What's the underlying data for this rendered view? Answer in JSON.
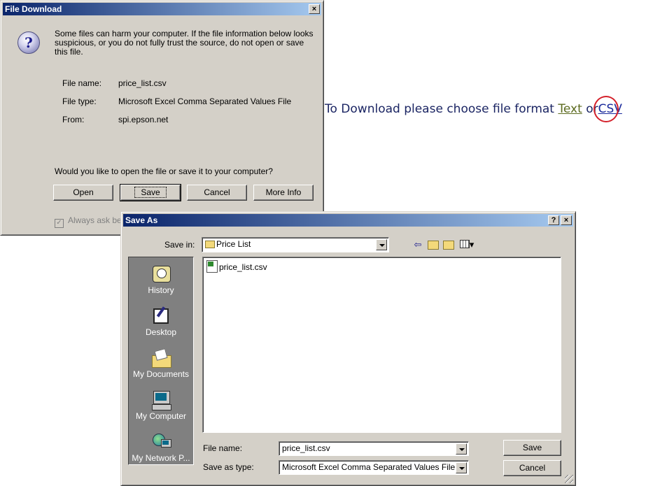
{
  "file_download": {
    "title": "File Download",
    "warning_text": "Some files can harm your computer. If the file information below looks suspicious, or you do not fully trust the source, do not open or save this file.",
    "file_name_label": "File name:",
    "file_name": "price_list.csv",
    "file_type_label": "File type:",
    "file_type": "Microsoft Excel Comma Separated Values File",
    "from_label": "From:",
    "from": "spi.epson.net",
    "question": "Would you like to open the file or save it to your computer?",
    "buttons": {
      "open": "Open",
      "save": "Save",
      "cancel": "Cancel",
      "more_info": "More Info"
    },
    "always_ask": "Always ask bef",
    "close_glyph": "×"
  },
  "page": {
    "prompt": "To Download please choose file format",
    "text_link": "Text",
    "or": "or",
    "csv_link": "CSV",
    "highlight_color": "#d4202a"
  },
  "save_as": {
    "title": "Save As",
    "help_glyph": "?",
    "close_glyph": "×",
    "save_in_label": "Save in:",
    "save_in_value": "Price List",
    "places": [
      {
        "label": "History",
        "icon": "history-icon"
      },
      {
        "label": "Desktop",
        "icon": "desktop-icon"
      },
      {
        "label": "My Documents",
        "icon": "my-documents-icon"
      },
      {
        "label": "My Computer",
        "icon": "my-computer-icon"
      },
      {
        "label": "My Network P...",
        "icon": "my-network-places-icon"
      }
    ],
    "files": [
      {
        "name": "price_list.csv",
        "icon": "excel-csv-file-icon"
      }
    ],
    "file_name_label": "File name:",
    "file_name_value": "price_list.csv",
    "save_as_type_label": "Save as type:",
    "save_as_type_value": "Microsoft Excel Comma Separated Values File",
    "save_button": "Save",
    "cancel_button": "Cancel",
    "toolbar": {
      "back_glyph": "⇦",
      "views_glyph": "▾"
    }
  }
}
